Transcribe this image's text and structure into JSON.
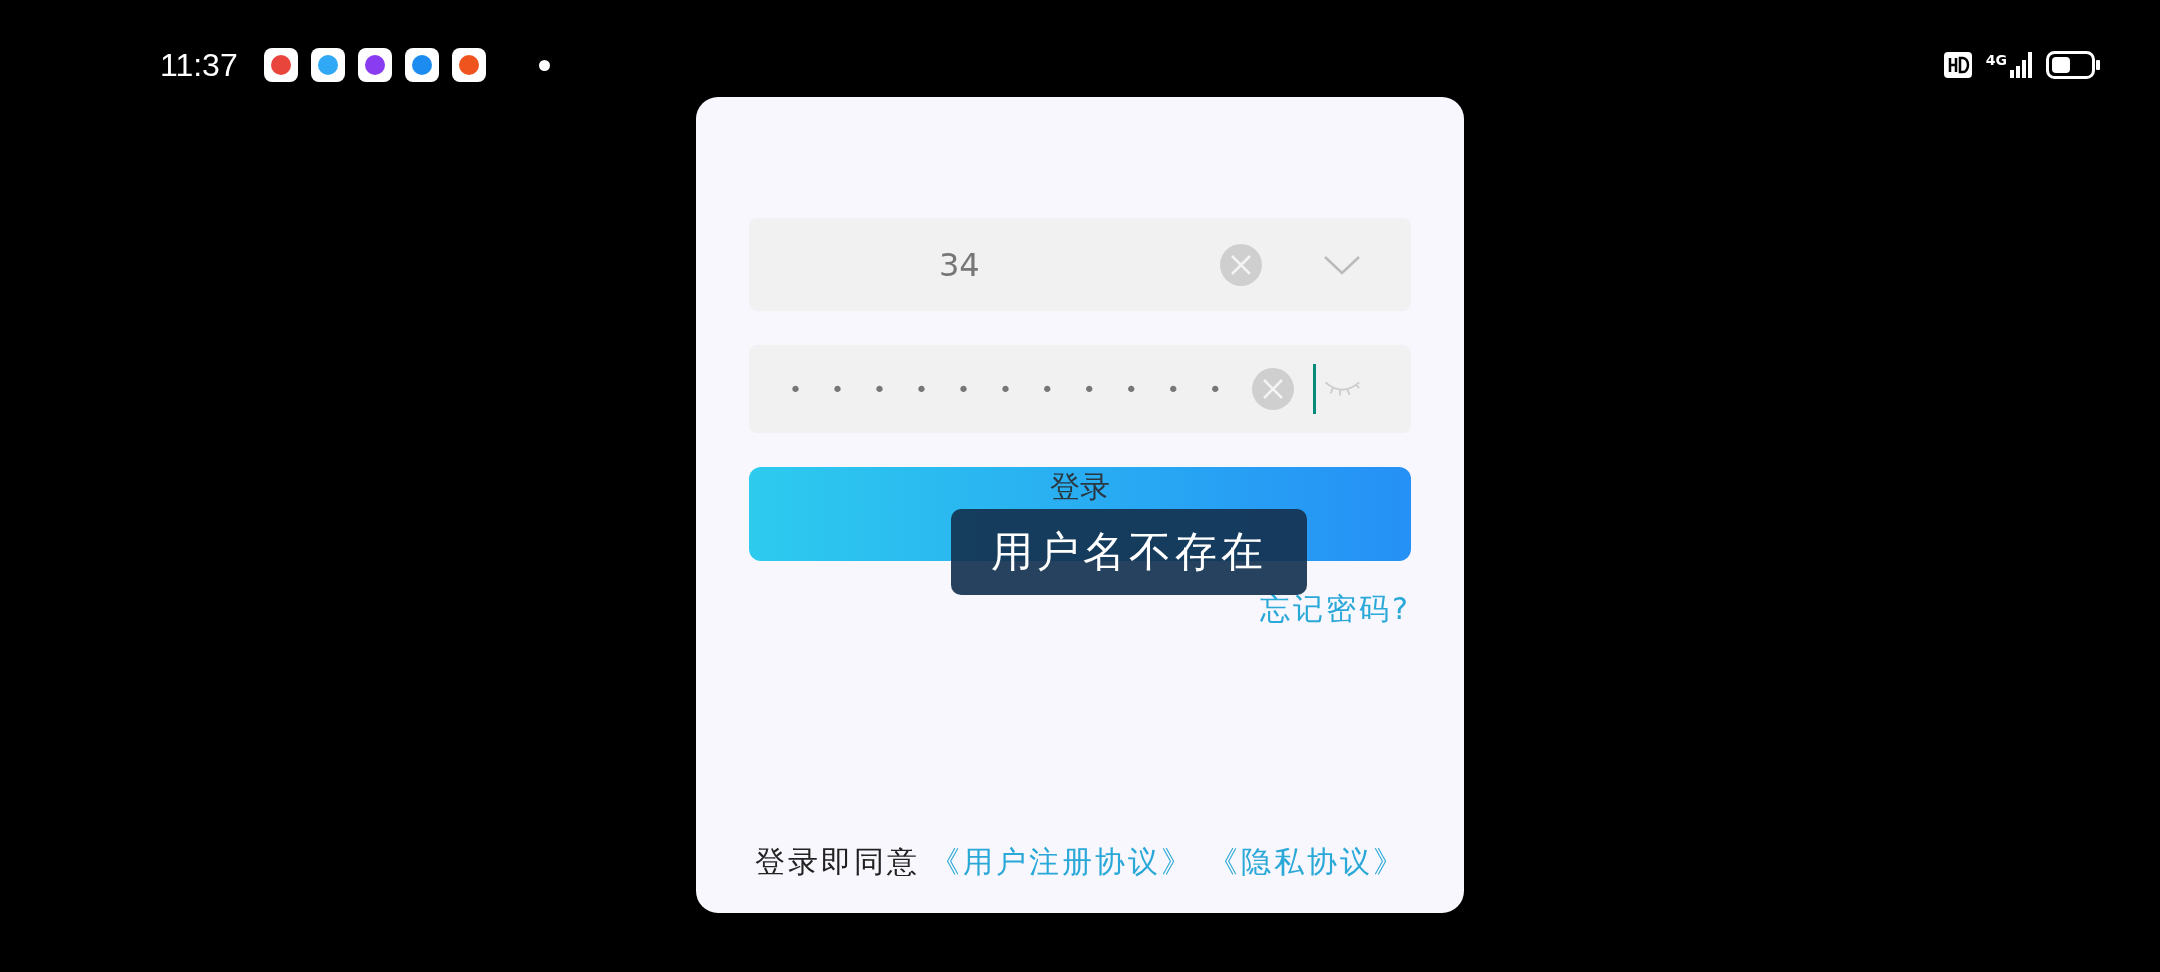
{
  "status_bar": {
    "time": "11:37",
    "notification_apps": [
      {
        "color": "#e8453c"
      },
      {
        "color": "#2fa8f5"
      },
      {
        "color": "#8a3cf0"
      },
      {
        "color": "#1d8cf0"
      },
      {
        "color": "#f0541e"
      }
    ],
    "network": "4G"
  },
  "login": {
    "username": {
      "value": "34"
    },
    "password": {
      "value": "•••••••••••",
      "visible": false
    },
    "login_button": "登录",
    "toast": "用户名不存在",
    "forgot_password": "忘记密码?",
    "agreement": {
      "text": "登录即同意",
      "links": [
        "《用户注册协议》",
        "《隐私协议》"
      ]
    }
  }
}
